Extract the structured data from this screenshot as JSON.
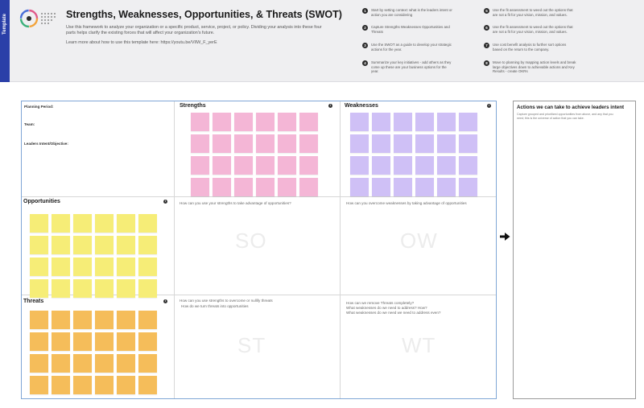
{
  "header": {
    "template_tab": "Template",
    "title": "Strengths, Weaknesses, Opportunities, & Threats (SWOT)",
    "description": "Use this framework to analyze your organization or a specific product, service, project, or policy. Dividing your analysis into these four parts helps clarify the existing forces that will affect your organization's future.",
    "learn_more": "Learn more about how to use this template here: https://youtu.be/VIlW_F_yerE",
    "steps": [
      {
        "num": "1",
        "text": "Start by setting context: what is the leaders intent or action you are considering"
      },
      {
        "num": "2",
        "text": "Capture Strengths Weaknesses Opportunities and Threats"
      },
      {
        "num": "3",
        "text": "Use the SWOT as a guide to develop your strategic actions for the year."
      },
      {
        "num": "4",
        "text": "Summarize your key initiatives - add others as they come up these are your business options for the year."
      },
      {
        "num": "5",
        "text": "Use the fit assessment to weed out the options that are not a fit for your vision, mission, and values."
      },
      {
        "num": "6",
        "text": "Use the fit assessment to weed out the options that are not a fit for your vision, mission, and values."
      },
      {
        "num": "7",
        "text": "Use cost benefit analysis to further sort options based on the return to the company."
      },
      {
        "num": "8",
        "text": "Move to planning by mapping action levels and break large objectives down to achievable actions and Key Results - create OKRs"
      }
    ]
  },
  "board": {
    "context": {
      "planning_period": "Planning Period:",
      "team": "Team:",
      "leaders_intent": "Leaders Intent/Objective:"
    },
    "strengths": {
      "title": "Strengths",
      "info": "i"
    },
    "weaknesses": {
      "title": "Weaknesses",
      "info": "i"
    },
    "opportunities": {
      "title": "Opportunities",
      "info": "i"
    },
    "threats": {
      "title": "Threats",
      "info": "i"
    },
    "so": {
      "prompt": "How can you use your strengths to take advantage of opportunities?",
      "watermark": "SO"
    },
    "ow": {
      "prompt": "How can you overcome weaknesses by taking advantage of opportunities",
      "watermark": "OW"
    },
    "st": {
      "prompt_1": "How can you use strengths to overcome or nullify threats",
      "prompt_2": "How do we turn threats into opportunities",
      "watermark": "ST"
    },
    "wt": {
      "prompt_1": "How can we remove Threats completely?",
      "prompt_2": "What weaknesses do we need to address? How?",
      "prompt_3": "What weaknesses do we need we need to address even?",
      "watermark": "WT"
    }
  },
  "sticky_notes": {
    "strengths": {
      "color": "#f4b6d6",
      "count": 24
    },
    "weaknesses": {
      "color": "#cfc0f6",
      "count": 24
    },
    "opportunities": {
      "color": "#f6ed77",
      "count": 24
    },
    "threats": {
      "color": "#f5bd5a",
      "count": 24
    }
  },
  "side_panel": {
    "title": "Actions we can take to achieve leaders intent",
    "description": "Capture grouped and prioritized opportunities from above, and any that you need; this is the universe of action that you can take."
  },
  "colors": {
    "template_tab": "#2a3fa8",
    "board_border": "#7fa6d6"
  }
}
